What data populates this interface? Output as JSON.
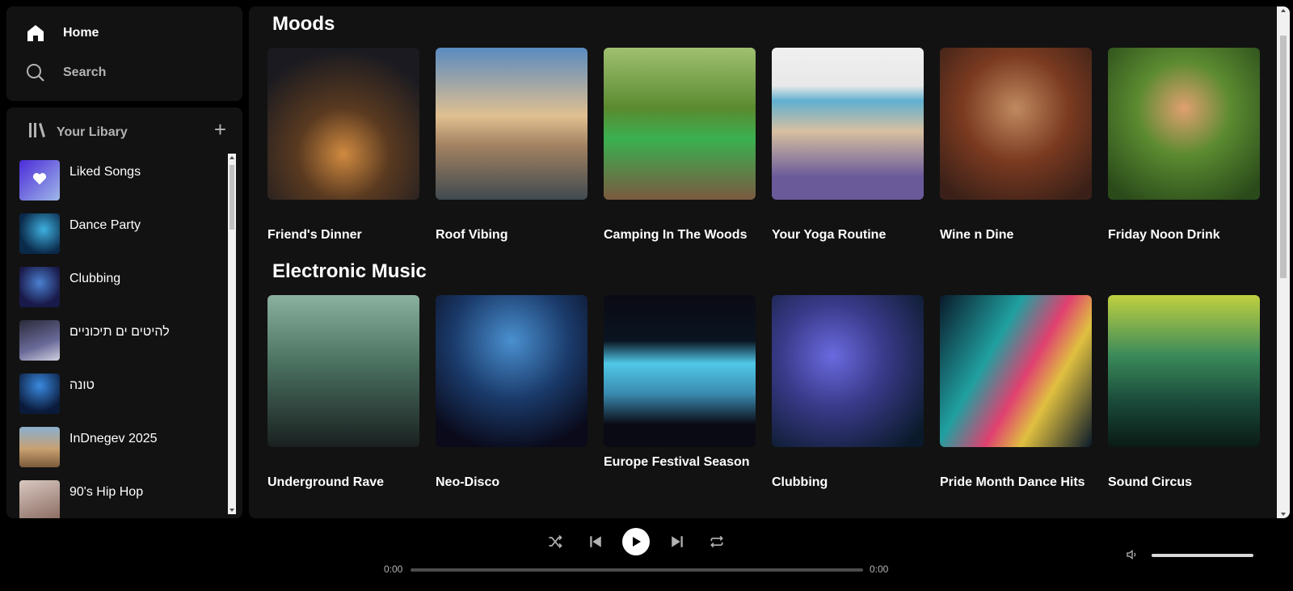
{
  "nav": {
    "home_label": "Home",
    "search_label": "Search"
  },
  "library": {
    "title": "Your Libary",
    "add_icon": "plus-icon",
    "items": [
      {
        "label": "Liked Songs",
        "color": "#6c4bf0"
      },
      {
        "label": "Dance Party",
        "color": "#1a6b8c"
      },
      {
        "label": "Clubbing",
        "color": "#2b3f7a"
      },
      {
        "label": "להיטים ים תיכוניים",
        "color": "#3a3a5a"
      },
      {
        "label": "טונה",
        "color": "#1b4fa0"
      },
      {
        "label": "InDnegev 2025",
        "color": "#b08a62"
      },
      {
        "label": "90's Hip Hop",
        "color": "#a88a80"
      }
    ]
  },
  "sections": [
    {
      "title": "Moods",
      "cards": [
        {
          "title": "Friend's Dinner",
          "color": "#4a3020"
        },
        {
          "title": "Roof Vibing",
          "color": "#7aa0c0"
        },
        {
          "title": "Camping In The Woods",
          "color": "#4f8a2a"
        },
        {
          "title": "Your Yoga Routine",
          "color": "#c8b49a"
        },
        {
          "title": "Wine n Dine",
          "color": "#8a4a30"
        },
        {
          "title": "Friday Noon Drink",
          "color": "#3f6a2a"
        }
      ]
    },
    {
      "title": "Electronic Music",
      "cards": [
        {
          "title": "Underground Rave",
          "color": "#4a7060"
        },
        {
          "title": "Neo-Disco",
          "color": "#1a3a6a"
        },
        {
          "title": "Europe Festival Season",
          "color": "#1b4a6a"
        },
        {
          "title": "Clubbing",
          "color": "#3a3a8a"
        },
        {
          "title": "Pride Month Dance Hits",
          "color": "#1a3050"
        },
        {
          "title": "Sound Circus",
          "color": "#2a6a4a"
        }
      ]
    }
  ],
  "player": {
    "time_current": "0:00",
    "time_total": "0:00",
    "controls": [
      "shuffle-icon",
      "previous-icon",
      "play-icon",
      "next-icon",
      "repeat-icon"
    ],
    "volume_icon": "volume-icon"
  }
}
